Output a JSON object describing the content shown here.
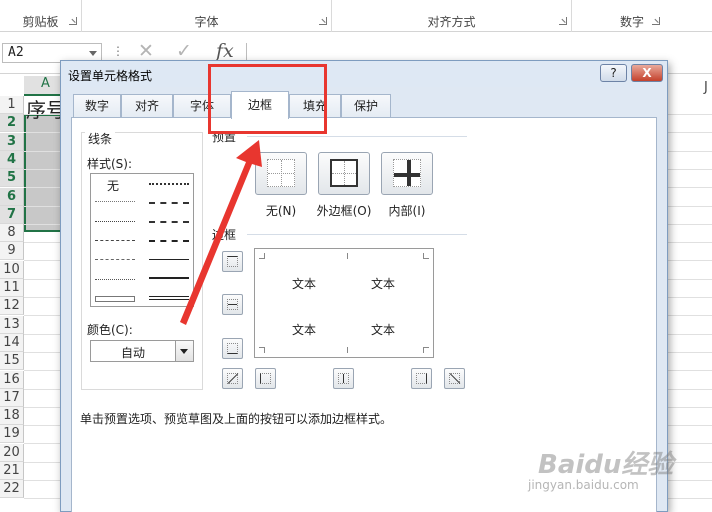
{
  "ribbon": {
    "groups": [
      {
        "label": "剪贴板"
      },
      {
        "label": "字体"
      },
      {
        "label": "对齐方式"
      },
      {
        "label": "数字"
      }
    ]
  },
  "formula_bar": {
    "name_box": "A2",
    "cancel_icon": "close-icon",
    "enter_icon": "check-icon",
    "function_icon": "fx-icon",
    "fx_text": "fx"
  },
  "sheet": {
    "columns": [
      "A",
      "J"
    ],
    "rows": [
      "1",
      "2",
      "3",
      "4",
      "5",
      "6",
      "7",
      "8",
      "9",
      "10",
      "11",
      "12",
      "13",
      "14",
      "15",
      "16",
      "17",
      "18",
      "19",
      "20",
      "21",
      "22"
    ],
    "selected_rows": [
      "2",
      "3",
      "4",
      "5",
      "6",
      "7"
    ],
    "a1_value": "序号",
    "accent": "#217346"
  },
  "dialog": {
    "title": "设置单元格格式",
    "help": "?",
    "close": "X",
    "tabs": [
      "数字",
      "对齐",
      "字体",
      "边框",
      "填充",
      "保护"
    ],
    "active_tab": "边框",
    "lines": {
      "section": "线条",
      "style_label": "样式(S):",
      "none_label": "无",
      "color_label": "颜色(C):",
      "color_value": "自动"
    },
    "presets": {
      "section": "预置",
      "items": [
        {
          "label": "无(N)",
          "icon": "border-none-icon"
        },
        {
          "label": "外边框(O)",
          "icon": "border-outline-icon"
        },
        {
          "label": "内部(I)",
          "icon": "border-inside-icon"
        }
      ]
    },
    "border": {
      "section": "边框",
      "preview_text": [
        "文本",
        "文本",
        "文本",
        "文本"
      ]
    },
    "hint": "单击预置选项、预览草图及上面的按钮可以添加边框样式。"
  },
  "annotation": {
    "color": "#e8362f"
  },
  "watermark": {
    "main": "Baidu经验",
    "sub": "jingyan.baidu.com"
  }
}
